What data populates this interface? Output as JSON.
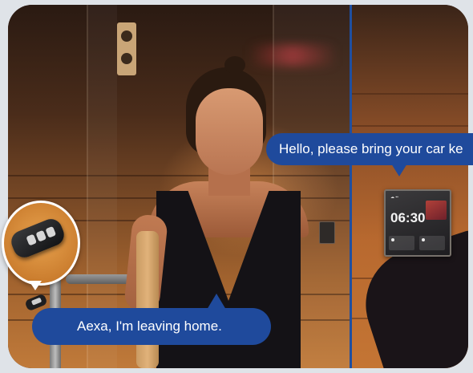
{
  "scene": {
    "left_bubble_text": "Aexa, I'm leaving home.",
    "right_bubble_text": "Hello, please bring your car ke",
    "panel_time": "06:30",
    "bubble_color": "#1f4a9c"
  }
}
